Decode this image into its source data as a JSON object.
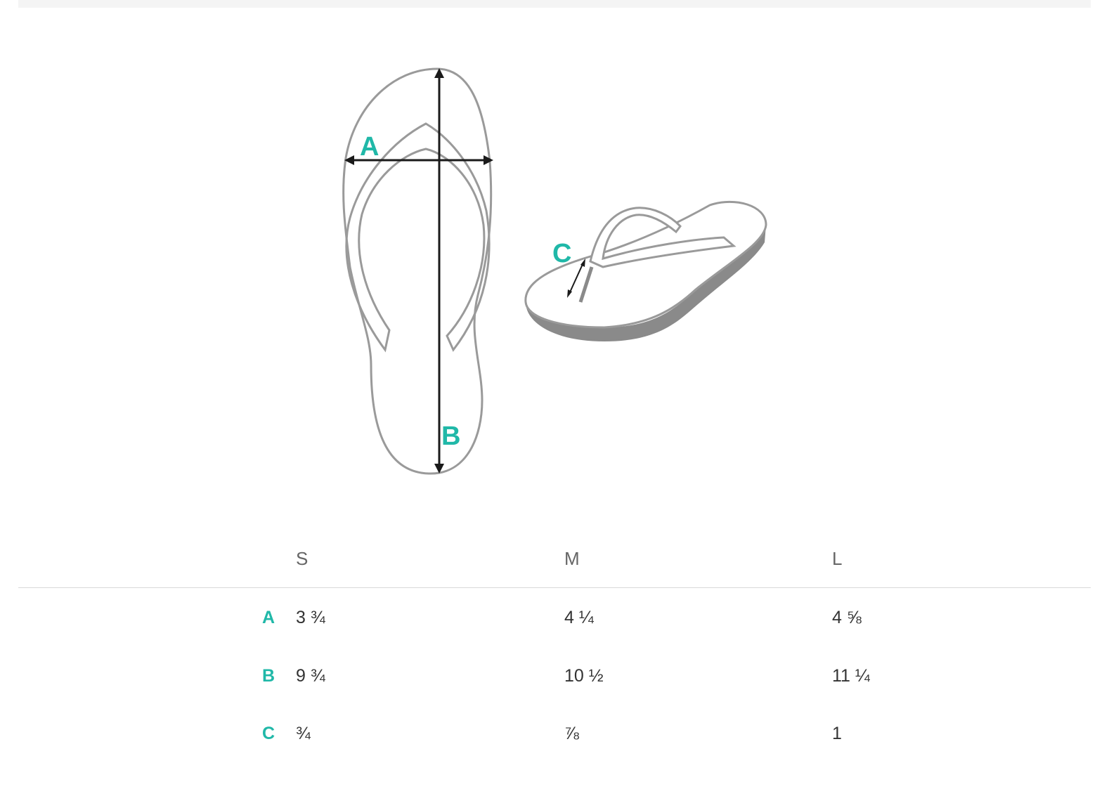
{
  "diagram": {
    "labels": {
      "a": "A",
      "b": "B",
      "c": "C"
    },
    "colors": {
      "accent": "#20b8a8",
      "outline": "#9a9a9a",
      "arrow": "#1a1a1a",
      "sole_edge": "#8a8a8a"
    }
  },
  "table": {
    "columns": [
      "S",
      "M",
      "L"
    ],
    "rows": [
      {
        "label": "A",
        "values": [
          "3 ¾",
          "4 ¼",
          "4 ⅝"
        ]
      },
      {
        "label": "B",
        "values": [
          "9 ¾",
          "10 ½",
          "11 ¼"
        ]
      },
      {
        "label": "C",
        "values": [
          "¾",
          "⅞",
          "1"
        ]
      }
    ]
  }
}
